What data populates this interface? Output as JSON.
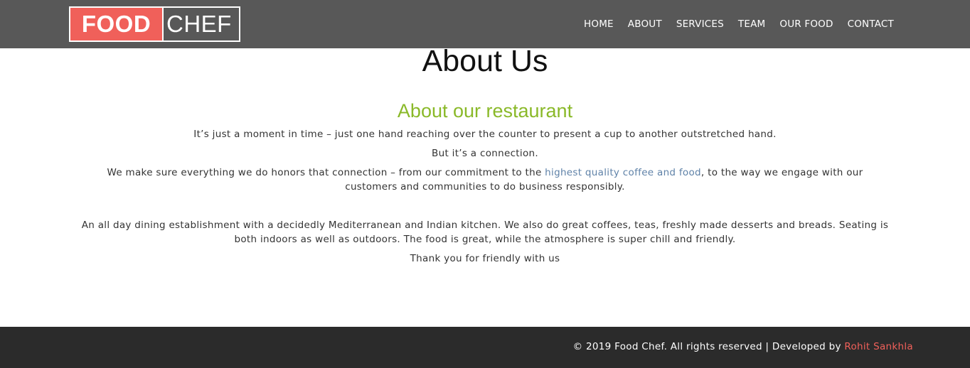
{
  "header": {
    "logo_left": "FOOD",
    "logo_right": "CHEF",
    "nav": [
      "HOME",
      "ABOUT",
      "SERVICES",
      "TEAM",
      "OUR FOOD",
      "CONTACT"
    ]
  },
  "main": {
    "page_title": "About Us",
    "section_title": "About our restaurant",
    "para1": "It’s just a moment in time – just one hand reaching over the counter to present a cup to another outstretched hand.",
    "para2": "But it’s a connection.",
    "para3_before": "We make sure everything we do honors that connection – from our commitment to the ",
    "para3_link": "highest quality coffee and food",
    "para3_after": ", to the way we engage with our customers and communities to do business responsibly.",
    "para4": "An all day dining establishment with a decidedly Mediterranean and Indian kitchen. We also do great coffees, teas, freshly made desserts and breads. Seating is both indoors as well as outdoors. The food is great, while the atmosphere is super chill and friendly.",
    "para5": "Thank you for friendly with us"
  },
  "footer": {
    "copyright": "© 2019 Food Chef. All rights reserved | Developed by ",
    "developer": "Rohit Sankhla"
  },
  "colors": {
    "nav_bg": "#585858",
    "logo_accent": "#f0605a",
    "section_title": "#8ab929",
    "link": "#5f82a8",
    "footer_bg": "#2b2b2b"
  }
}
